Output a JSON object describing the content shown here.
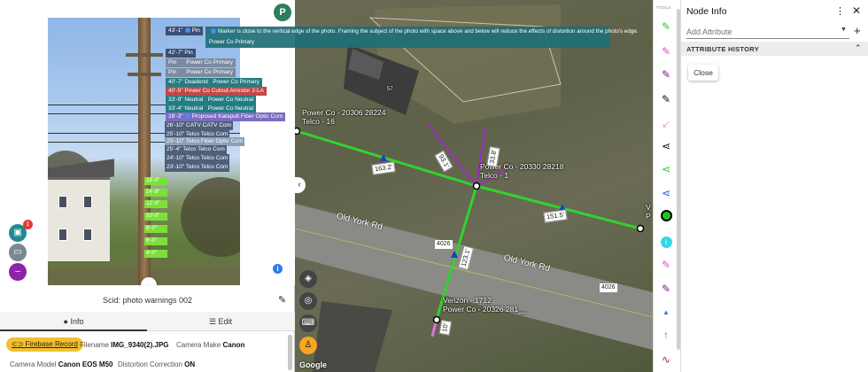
{
  "photo": {
    "avatar_letter": "P",
    "warning_line1": "Marker is close to the vertical edge of the photo. Framing the subject of the photo with space above and below will reduce the effects of distortion around the photo's edge.",
    "warning_line2": "Power Co Primary",
    "tags": [
      {
        "height": "43'-1\"",
        "text": "Pin"
      },
      {
        "height": "42'-7\"",
        "text": "Pin"
      },
      {
        "height": "",
        "text": "Pin"
      },
      {
        "height": "",
        "text": "Pin"
      },
      {
        "height": "40'-7\"",
        "text": "Deadend"
      },
      {
        "height": "40'-5\"",
        "text": "Power Co Cutout Arrestor 2-LA"
      },
      {
        "height": "33'-9\"",
        "text": "Neutral"
      },
      {
        "height": "33'-4\"",
        "text": "Neutral"
      },
      {
        "height": "28'-3\"",
        "text": "Proposed Katapult Fiber Optic Com"
      },
      {
        "height": "26'-10\"",
        "text": "CATV CATV Com"
      },
      {
        "height": "25'-10\"",
        "text": "Telco Telco Com"
      },
      {
        "height": "25'-10\"",
        "text": "Telco Fiber Optic Com"
      },
      {
        "height": "25'-4\"",
        "text": "Telco Telco Com"
      },
      {
        "height": "24'-10\"",
        "text": "Telco Telco Com"
      },
      {
        "height": "23'-10\"",
        "text": "Telco Telco Com"
      }
    ],
    "side_tags": [
      "Power Co Primary",
      "Power Co Primary",
      "Power Co Primary",
      "Power Co Primary",
      "Power Co Neutral",
      "Power Co Neutral"
    ],
    "green_marks": [
      "18'-0\"",
      "14'-8\"",
      "12'-0\"",
      "10'-0\"",
      "8'-0\"",
      "6'-0\"",
      "4'-0\""
    ]
  },
  "fab_badge": "1",
  "scid": "Scid: photo warnings 002",
  "tabs": {
    "info": "Info",
    "edit": "Edit"
  },
  "info": {
    "firebase_record": "Firebase Record",
    "filename_label": "Filename",
    "filename_value": "IMG_9340(2).JPG",
    "camera_make_label": "Camera Make",
    "camera_make_value": "Canon",
    "camera_model_label": "Camera Model",
    "camera_model_value": "Canon EOS M50",
    "distortion_label": "Distortion Correction",
    "distortion_value": "ON"
  },
  "map": {
    "node_labels": [
      {
        "line1": "Power Co - 20306 28224",
        "line2": "Telco - 16"
      },
      {
        "line1": "Power Co - 20330 28218",
        "line2": "Telco - 1"
      },
      {
        "line1": "Verizon - 1712",
        "line2": "Power Co - 20326 281__"
      },
      {
        "line1": "V",
        "line2": "P"
      }
    ],
    "spans": [
      "163.2'",
      "151.5'",
      "123.1'",
      "93.1'",
      "33.8'",
      "10'"
    ],
    "roads": [
      "Old York Rd",
      "Old York Rd"
    ],
    "route_numbers": [
      "4026",
      "4026"
    ],
    "building_number": "57",
    "google": "Google"
  },
  "tools_label": "TOOLS",
  "node_panel": {
    "title": "Node Info",
    "add_attribute_placeholder": "Add Attribute",
    "attribute_history": "ATTRIBUTE HISTORY",
    "close_button": "Close"
  },
  "colors": {
    "accent_teal": "#237d83",
    "map_line": "#32d22e",
    "firebase": "#f3c12e"
  }
}
